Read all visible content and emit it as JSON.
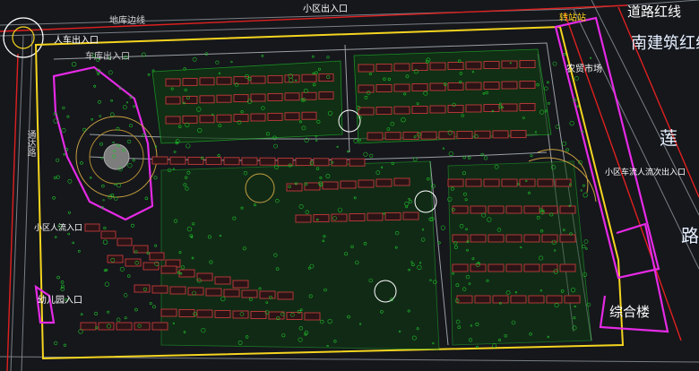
{
  "labels": {
    "residential_entrance_top": "小区出入口",
    "road_edge_line": "地库边线",
    "pedestrian_vehicle_entrance": "人车出入口",
    "vehicle_entrance": "车库出入口",
    "transfer_station": "转站站",
    "farmers_market": "农贸市场",
    "road_building_line": "道路红线",
    "south_building_line": "南建筑红线",
    "lian_char": "莲",
    "lu_char": "路",
    "left_road_vertical": "通达路",
    "left_side_entrance": "小区人流入口",
    "kindergarten_entrance": "幼儿园入口",
    "side_entrance_right": "小区车流人流次出入口",
    "complex_building": "综合楼"
  },
  "colors": {
    "background": "#15171b",
    "building_outline": "#c33a3a",
    "greenery": "#1fbf2a",
    "boundary_magenta": "#e52ae5",
    "road_yellow": "#f5d51f",
    "road_red": "#e02020",
    "label_white": "#ffffff",
    "label_yellow": "#ffd21a",
    "road_gray": "#7a7f86"
  }
}
